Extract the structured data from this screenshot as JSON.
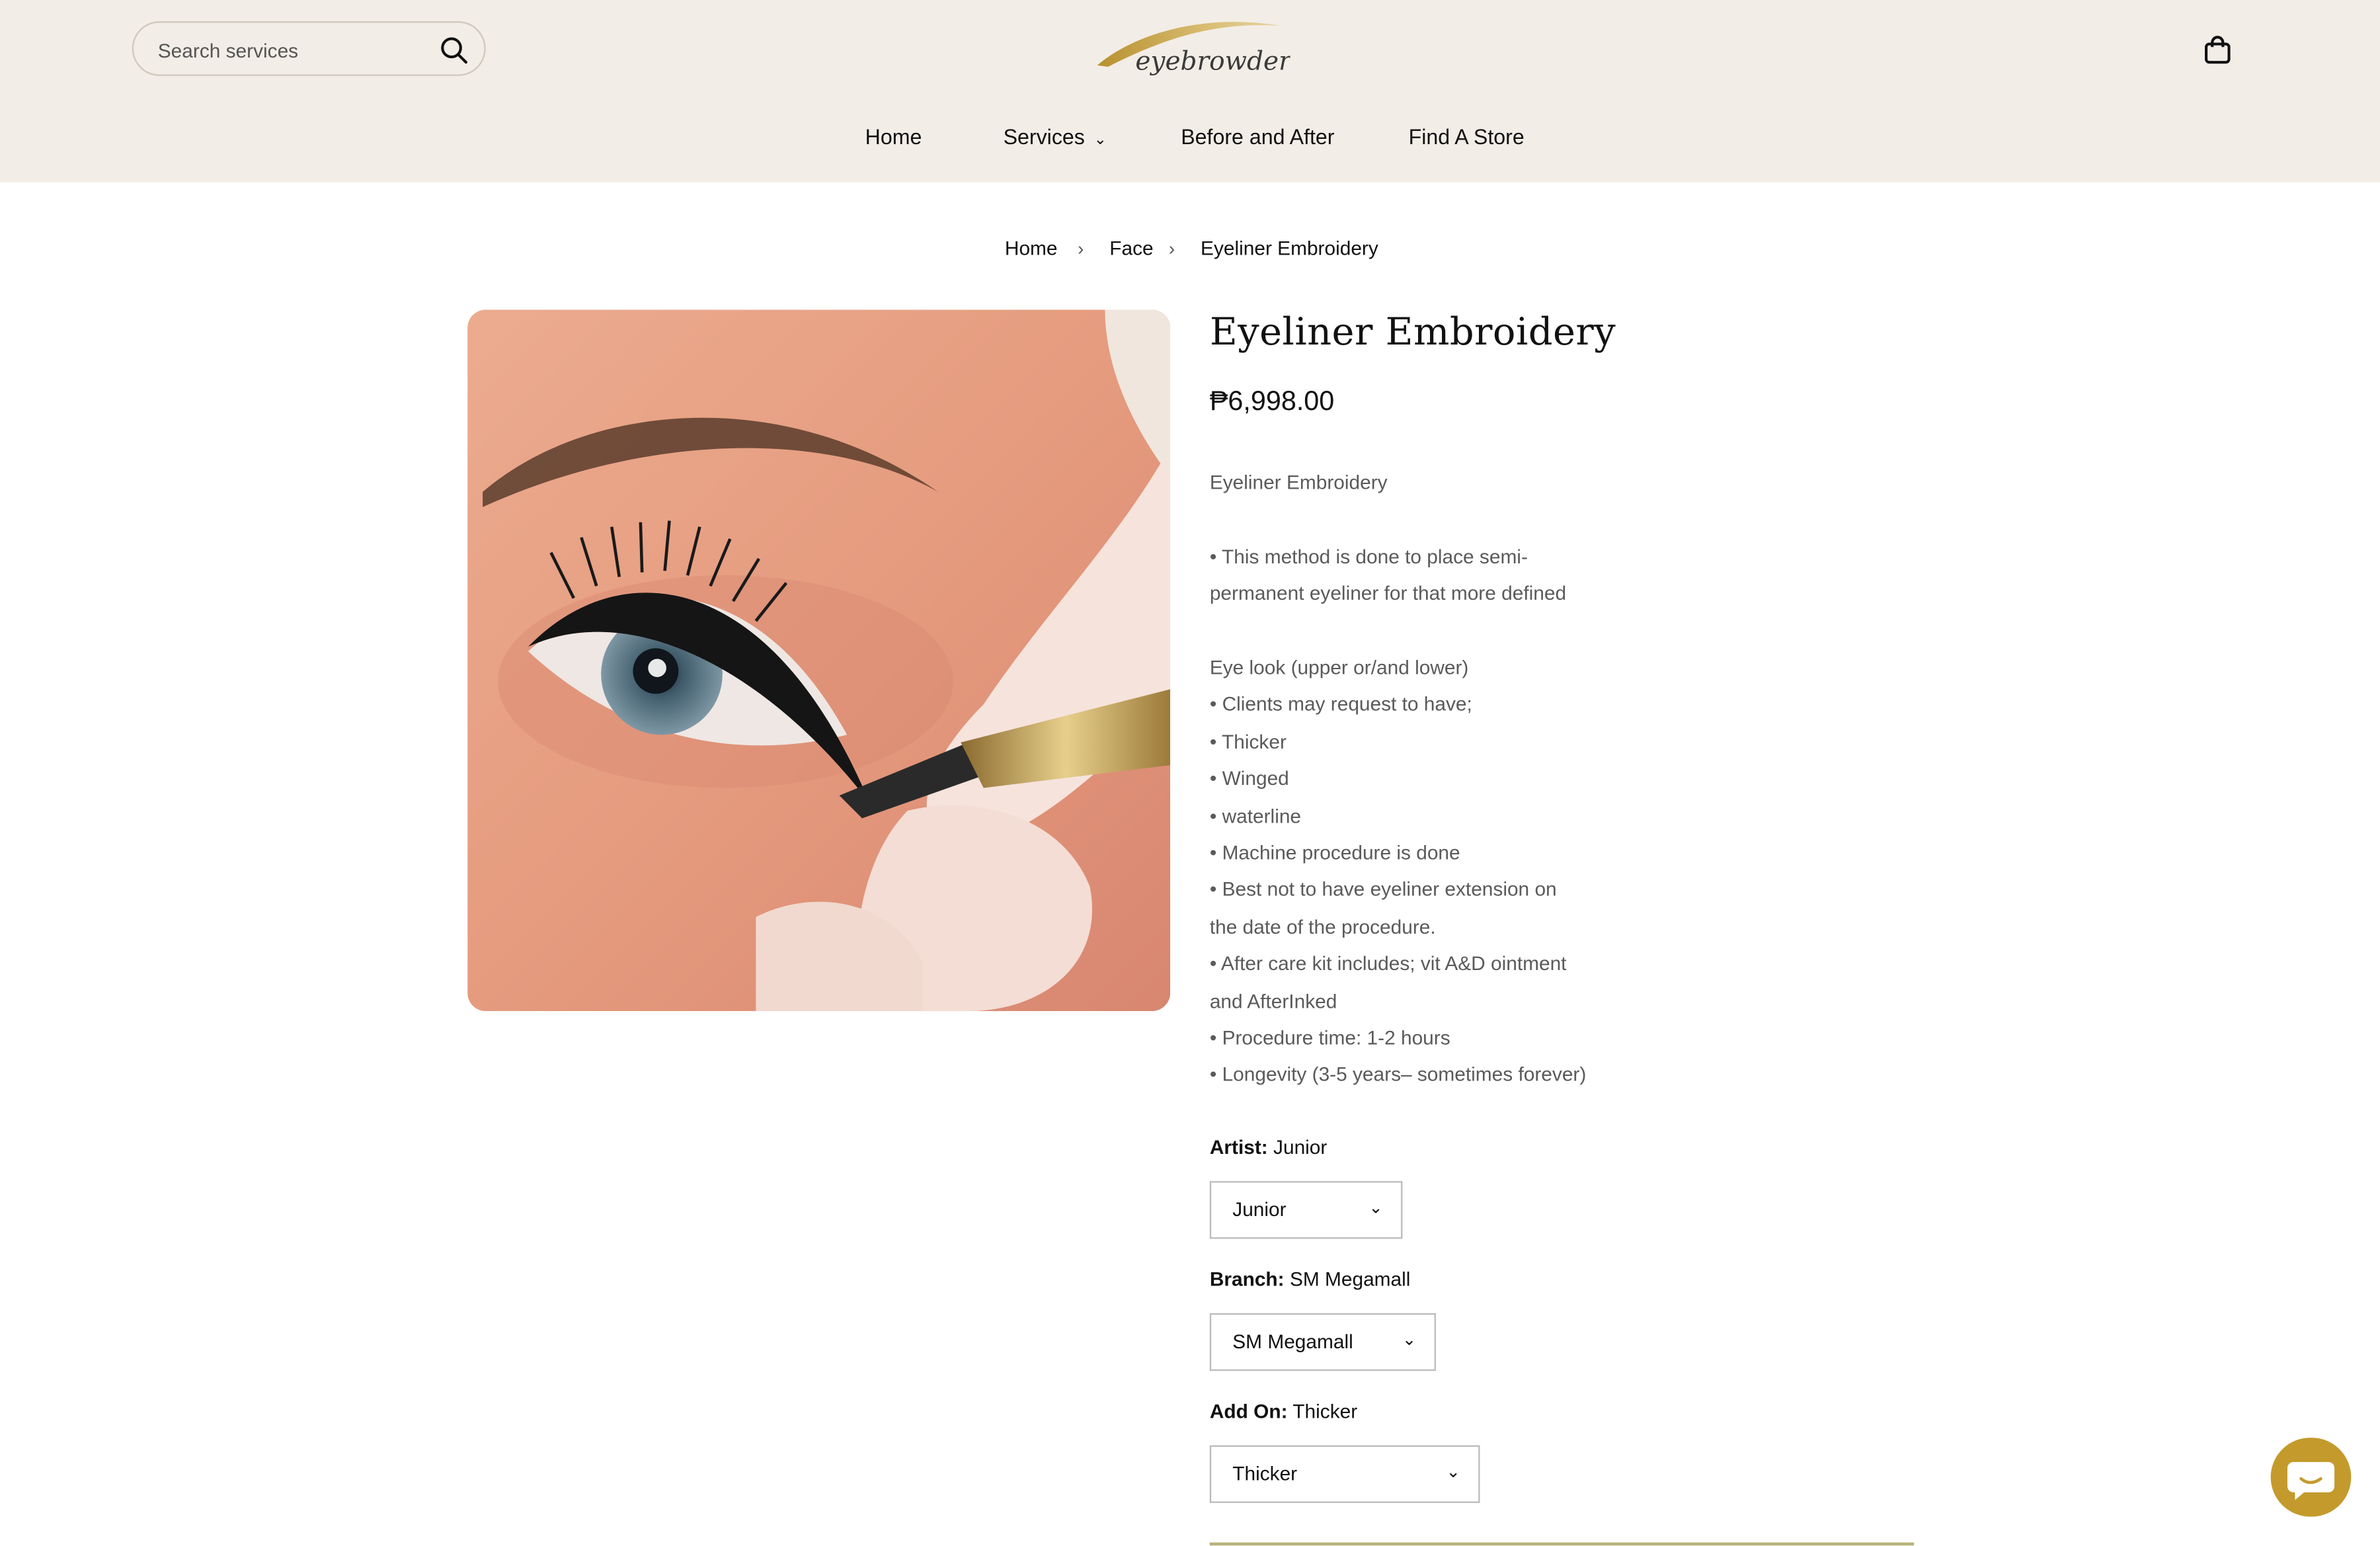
{
  "header": {
    "search": {
      "placeholder": "Search services"
    },
    "logo_text": "eyebrowdery",
    "nav": [
      {
        "label": "Home"
      },
      {
        "label": "Services"
      },
      {
        "label": "Before and After"
      },
      {
        "label": "Find A Store"
      }
    ],
    "nav_services_chevron": "⌄"
  },
  "breadcrumb": {
    "items": [
      "Home",
      "Face",
      "Eyeliner Embroidery"
    ],
    "separator": "›"
  },
  "product": {
    "title": "Eyeliner Embroidery",
    "price": "₱6,998.00",
    "description": [
      "Eyeliner Embroidery",
      "",
      "• This method is done to place semi-",
      "permanent eyeliner for that more defined",
      "",
      "Eye look (upper or/and lower)",
      "• Clients may request to have;",
      "• Thicker",
      "• Winged",
      "• waterline",
      "• Machine procedure is done",
      "• Best not to have eyeliner extension on",
      "the date of the procedure.",
      "• After care kit includes; vit A&D ointment",
      "and AfterInked",
      "• Procedure time: 1-2 hours",
      "• Longevity (3-5 years– sometimes forever)"
    ],
    "options": [
      {
        "label": "Artist:",
        "value": "Junior",
        "selected": "Junior"
      },
      {
        "label": "Branch:",
        "value": "SM Megamall",
        "selected": "SM Megamall"
      },
      {
        "label": "Add On:",
        "value": "Thicker",
        "selected": "Thicker"
      }
    ]
  },
  "colors": {
    "header_bg": "#f2ede6",
    "accent_gold": "#c49a2c",
    "divider": "#b9b27a"
  },
  "icons": {
    "search": "search-icon",
    "cart": "shopping-bag-icon",
    "chat": "chat-icon",
    "select_arrow": "chevron-down-icon"
  }
}
